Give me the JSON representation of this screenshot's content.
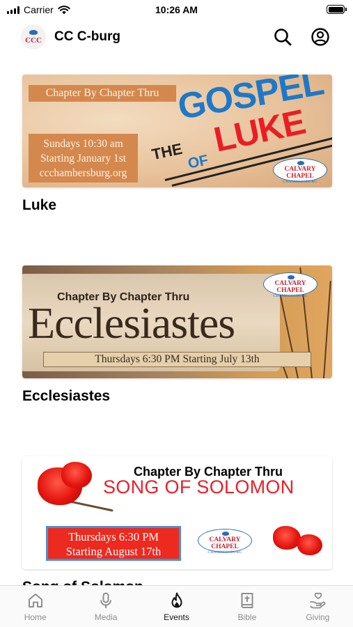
{
  "status_bar": {
    "carrier": "Carrier",
    "time": "10:26 AM"
  },
  "header": {
    "logo_text": "CCC",
    "app_title": "CC C-burg",
    "icons": [
      "search-icon",
      "account-icon"
    ]
  },
  "events": [
    {
      "title": "Luke",
      "banner": {
        "kicker": "Chapter By Chapter Thru",
        "line1": "Sundays 10:30 am",
        "line2": "Starting January 1st",
        "line3": "ccchambersburg.org",
        "word_the": "THE",
        "word_gospel": "GOSPEL",
        "word_of": "OF",
        "word_luke": "LUKE",
        "badge_name": "CALVARY CHAPEL",
        "badge_sub": "CHAMBERSBURG"
      }
    },
    {
      "title": "Ecclesiastes",
      "banner": {
        "kicker": "Chapter By Chapter Thru",
        "book": "Ecclesiastes",
        "schedule": "Thursdays 6:30 PM Starting July 13th",
        "badge_name": "CALVARY CHAPEL",
        "badge_sub": "CHAMBERSBURG"
      }
    },
    {
      "title": "Song of Solomon",
      "banner": {
        "kicker": "Chapter By Chapter Thru",
        "book": "SONG OF SOLOMON",
        "line1": "Thursdays 6:30 PM",
        "line2": "Starting August 17th",
        "badge_name": "CALVARY CHAPEL",
        "badge_sub": "CHAMBERSBURG"
      }
    }
  ],
  "tabs": [
    {
      "label": "Home",
      "icon": "home-icon",
      "active": false
    },
    {
      "label": "Media",
      "icon": "microphone-icon",
      "active": false
    },
    {
      "label": "Events",
      "icon": "flame-icon",
      "active": true
    },
    {
      "label": "Bible",
      "icon": "bible-icon",
      "active": false
    },
    {
      "label": "Giving",
      "icon": "giving-hand-icon",
      "active": false
    }
  ],
  "colors": {
    "accent_red": "#e8202a",
    "accent_blue": "#1d79c7",
    "tab_inactive": "#8e8e8e",
    "tab_active": "#111111"
  }
}
